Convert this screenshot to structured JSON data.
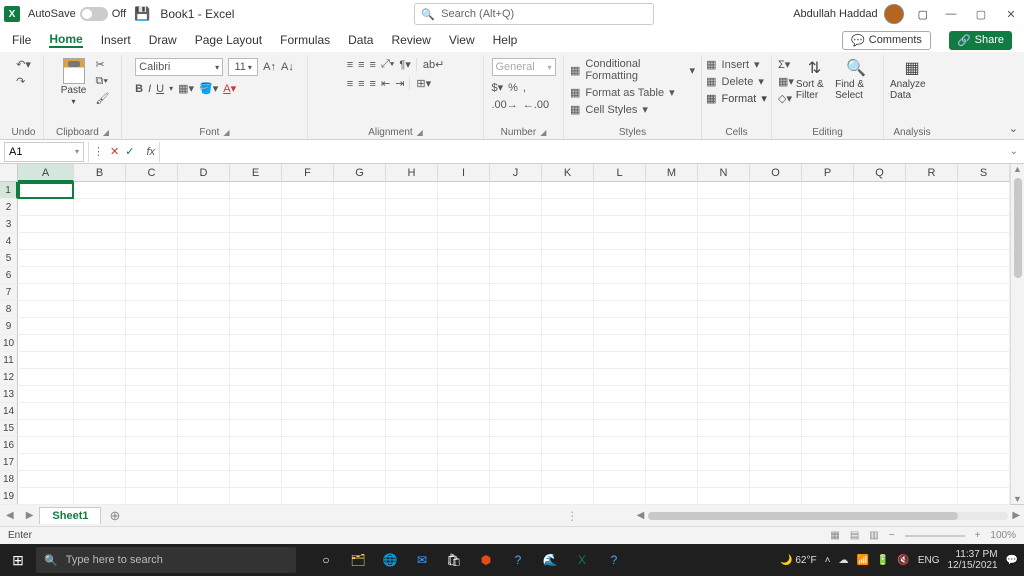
{
  "titlebar": {
    "autosave_label": "AutoSave",
    "autosave_state": "Off",
    "doc_title": "Book1 - Excel",
    "search_placeholder": "Search (Alt+Q)",
    "user_name": "Abdullah Haddad"
  },
  "tabs": {
    "file": "File",
    "home": "Home",
    "insert": "Insert",
    "draw": "Draw",
    "page_layout": "Page Layout",
    "formulas": "Formulas",
    "data": "Data",
    "review": "Review",
    "view": "View",
    "help": "Help",
    "comments": "Comments",
    "share": "Share"
  },
  "ribbon": {
    "undo": {
      "label": "Undo"
    },
    "clipboard": {
      "label": "Clipboard",
      "paste": "Paste"
    },
    "font": {
      "label": "Font",
      "name": "Calibri",
      "size": "11",
      "bold": "B",
      "italic": "I",
      "underline": "U"
    },
    "alignment": {
      "label": "Alignment"
    },
    "number": {
      "label": "Number",
      "format": "General"
    },
    "styles": {
      "label": "Styles",
      "conditional": "Conditional Formatting",
      "table": "Format as Table",
      "cell": "Cell Styles"
    },
    "cells": {
      "label": "Cells",
      "insert": "Insert",
      "delete": "Delete",
      "format": "Format"
    },
    "editing": {
      "label": "Editing",
      "sort": "Sort & Filter",
      "find": "Find & Select"
    },
    "analysis": {
      "label": "Analysis",
      "analyze": "Analyze Data"
    }
  },
  "formula_bar": {
    "cell_ref": "A1",
    "fx": "fx"
  },
  "columns": [
    "A",
    "B",
    "C",
    "D",
    "E",
    "F",
    "G",
    "H",
    "I",
    "J",
    "K",
    "L",
    "M",
    "N",
    "O",
    "P",
    "Q",
    "R",
    "S"
  ],
  "rows": [
    "1",
    "2",
    "3",
    "4",
    "5",
    "6",
    "7",
    "8",
    "9",
    "10",
    "11",
    "12",
    "13",
    "14",
    "15",
    "16",
    "17",
    "18",
    "19"
  ],
  "sheet_tabs": {
    "sheet1": "Sheet1"
  },
  "statusbar": {
    "mode": "Enter",
    "zoom": "100%"
  },
  "taskbar": {
    "search_placeholder": "Type here to search",
    "weather": "62°F",
    "lang": "ENG",
    "time": "11:37 PM",
    "date": "12/15/2021"
  }
}
